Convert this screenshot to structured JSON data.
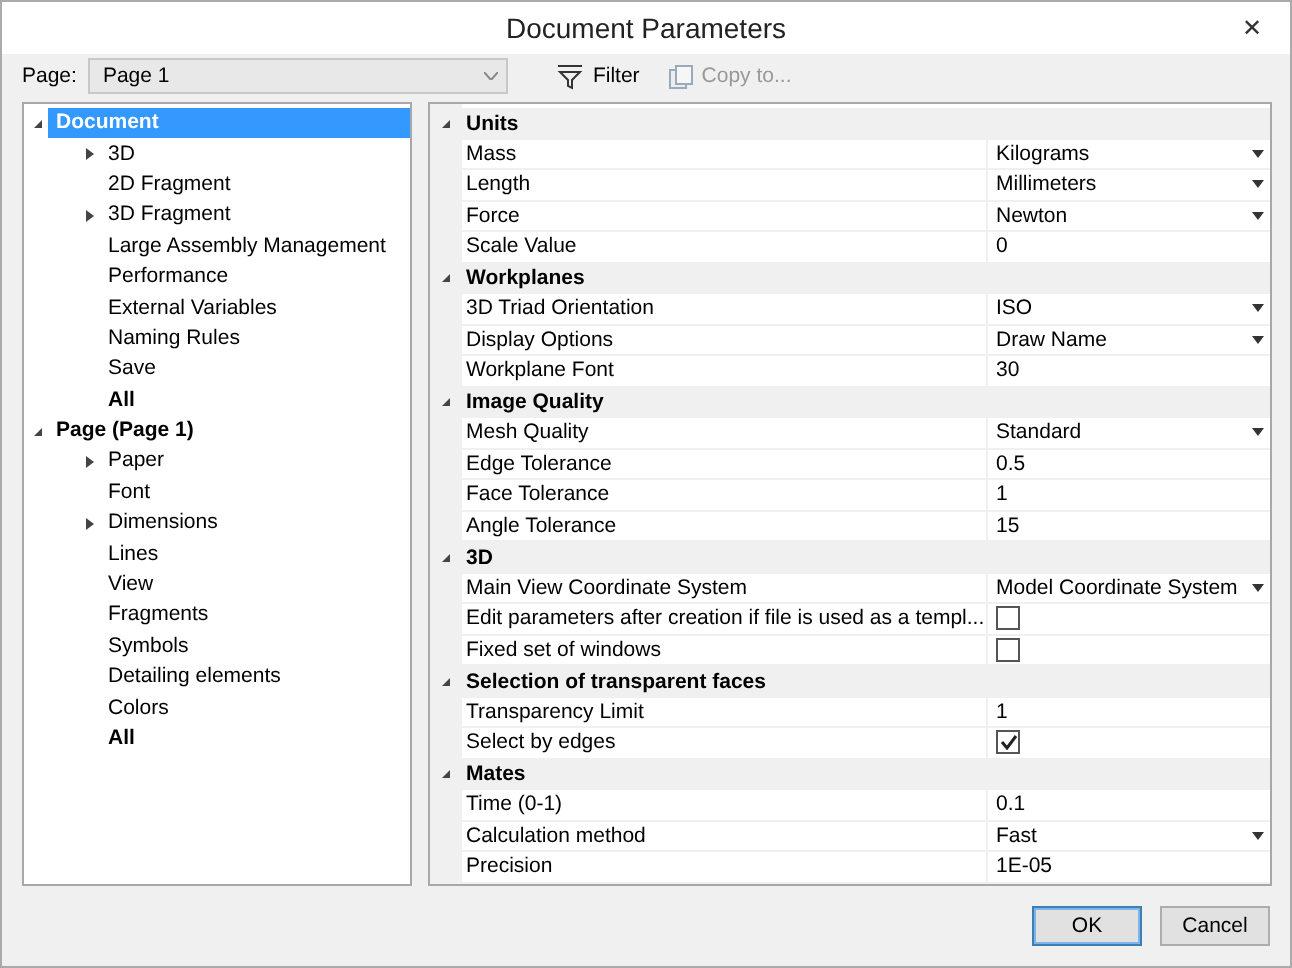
{
  "window": {
    "title": "Document Parameters",
    "close": "✕"
  },
  "page_selector": {
    "label": "Page:",
    "value": "Page 1"
  },
  "toolbar": [
    {
      "label": "Filter",
      "disabled": false
    },
    {
      "label": "Copy to...",
      "disabled": true
    }
  ],
  "tree": [
    {
      "label": "Document",
      "selected": true,
      "bold": true,
      "expanded": true,
      "children": [
        {
          "label": "3D",
          "selected": false,
          "bold": false,
          "expanded": false
        },
        {
          "label": "2D Fragment",
          "selected": false,
          "bold": false
        },
        {
          "label": "3D Fragment",
          "selected": false,
          "bold": false,
          "expanded": false
        },
        {
          "label": "Large Assembly Management",
          "selected": false,
          "bold": false
        },
        {
          "label": "Performance",
          "selected": false,
          "bold": false
        },
        {
          "label": "External Variables",
          "selected": false,
          "bold": false
        },
        {
          "label": "Naming Rules",
          "selected": false,
          "bold": false
        },
        {
          "label": "Save",
          "selected": false,
          "bold": false
        },
        {
          "label": "All",
          "selected": false,
          "bold": true
        }
      ]
    },
    {
      "label": "Page (Page 1)",
      "selected": false,
      "bold": true,
      "expanded": true,
      "children": [
        {
          "label": "Paper",
          "selected": false,
          "bold": false,
          "expanded": false
        },
        {
          "label": "Font",
          "selected": false,
          "bold": false
        },
        {
          "label": "Dimensions",
          "selected": false,
          "bold": false,
          "expanded": false
        },
        {
          "label": "Lines",
          "selected": false,
          "bold": false
        },
        {
          "label": "View",
          "selected": false,
          "bold": false
        },
        {
          "label": "Fragments",
          "selected": false,
          "bold": false
        },
        {
          "label": "Symbols",
          "selected": false,
          "bold": false
        },
        {
          "label": "Detailing elements",
          "selected": false,
          "bold": false
        },
        {
          "label": "Colors",
          "selected": false,
          "bold": false
        },
        {
          "label": "All",
          "selected": false,
          "bold": true
        }
      ]
    }
  ],
  "properties": [
    {
      "group": "Units",
      "expanded": true,
      "rows": [
        {
          "name": "Mass",
          "kind": "dropdown",
          "value": "Kilograms"
        },
        {
          "name": "Length",
          "kind": "dropdown",
          "value": "Millimeters"
        },
        {
          "name": "Force",
          "kind": "dropdown",
          "value": "Newton"
        },
        {
          "name": "Scale Value",
          "kind": "text",
          "value": "0"
        }
      ]
    },
    {
      "group": "Workplanes",
      "expanded": true,
      "rows": [
        {
          "name": "3D Triad Orientation",
          "kind": "dropdown",
          "value": "ISO"
        },
        {
          "name": "Display Options",
          "kind": "dropdown",
          "value": "Draw Name"
        },
        {
          "name": "Workplane Font",
          "kind": "text",
          "value": "30"
        }
      ]
    },
    {
      "group": "Image Quality",
      "expanded": true,
      "rows": [
        {
          "name": "Mesh Quality",
          "kind": "dropdown",
          "value": "Standard"
        },
        {
          "name": "Edge Tolerance",
          "kind": "text",
          "value": "0.5"
        },
        {
          "name": "Face Tolerance",
          "kind": "text",
          "value": "1"
        },
        {
          "name": "Angle Tolerance",
          "kind": "text",
          "value": "15"
        }
      ]
    },
    {
      "group": "3D",
      "expanded": true,
      "rows": [
        {
          "name": "Main View Coordinate System",
          "kind": "dropdown",
          "value": "Model Coordinate System"
        },
        {
          "name": "Edit parameters after creation if file is used as a templ...",
          "kind": "checkbox",
          "checked": false
        },
        {
          "name": "Fixed set of windows",
          "kind": "checkbox",
          "checked": false
        }
      ]
    },
    {
      "group": "Selection of transparent faces",
      "expanded": true,
      "rows": [
        {
          "name": "Transparency Limit",
          "kind": "text",
          "value": "1"
        },
        {
          "name": "Select by edges",
          "kind": "checkbox",
          "checked": true
        }
      ]
    },
    {
      "group": "Mates",
      "expanded": true,
      "rows": [
        {
          "name": "Time (0-1)",
          "kind": "text",
          "value": "0.1"
        },
        {
          "name": "Calculation method",
          "kind": "dropdown",
          "value": "Fast"
        },
        {
          "name": "Precision",
          "kind": "text",
          "value": "1E-05"
        }
      ]
    }
  ],
  "buttons": [
    {
      "label": "OK",
      "default": true
    },
    {
      "label": "Cancel",
      "default": false
    }
  ]
}
